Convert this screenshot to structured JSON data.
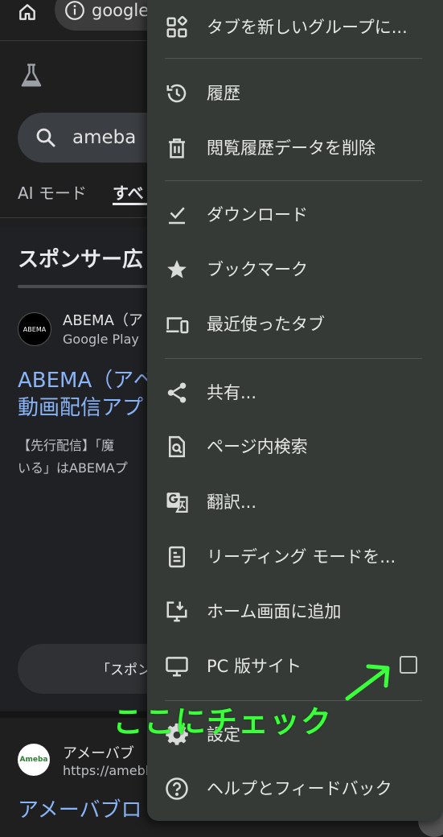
{
  "background_page": {
    "url_text": "google",
    "search_query": "ameba",
    "tabs": [
      {
        "label": "AI モード"
      },
      {
        "label": "すべ"
      }
    ],
    "sponsor_heading": "スポンサー広",
    "ad": {
      "logo_text": "ABEMA",
      "site_name": "ABEMA（ア",
      "source": "Google Play",
      "title_line1": "ABEMA（アベ",
      "title_line2": "動画配信アプ",
      "desc_line1": "【先行配信】「魔",
      "desc_line2": "いる」はABEMAプ"
    },
    "sponsor_more_button": "「スポン",
    "result": {
      "logo_text": "Ameba",
      "site_name": "アメーバブ",
      "url": "https://amebl",
      "title": "アメーバブロ"
    }
  },
  "menu": {
    "items": [
      {
        "label": "タブを新しいグループに...",
        "icon": "tab-group-icon"
      },
      {
        "label": "履歴",
        "icon": "history-icon"
      },
      {
        "label": "閲覧履歴データを削除",
        "icon": "trash-icon"
      },
      {
        "label": "ダウンロード",
        "icon": "download-check-icon"
      },
      {
        "label": "ブックマーク",
        "icon": "star-icon"
      },
      {
        "label": "最近使ったタブ",
        "icon": "devices-icon"
      },
      {
        "label": "共有...",
        "icon": "share-icon"
      },
      {
        "label": "ページ内検索",
        "icon": "find-in-page-icon"
      },
      {
        "label": "翻訳...",
        "icon": "translate-icon"
      },
      {
        "label": "リーディング モードを...",
        "icon": "reading-mode-icon"
      },
      {
        "label": "ホーム画面に追加",
        "icon": "add-to-home-icon"
      },
      {
        "label": "PC 版サイト",
        "icon": "monitor-icon",
        "checkbox_checked": false
      },
      {
        "label": "設定",
        "icon": "gear-icon"
      },
      {
        "label": "ヘルプとフィードバック",
        "icon": "help-icon"
      }
    ]
  },
  "annotation": {
    "text": "ここにチェック",
    "color": "#3bff3b"
  },
  "colors": {
    "menu_background": "#353a36",
    "link_blue": "#8ab4f8",
    "page_background": "#1f1f1f"
  }
}
